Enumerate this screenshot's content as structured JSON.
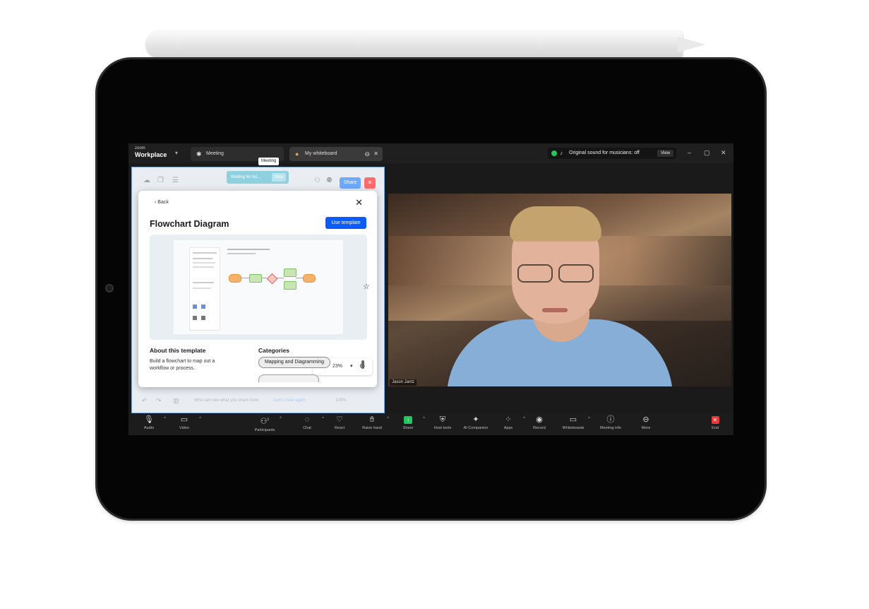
{
  "app": {
    "brand_top": "zoom",
    "brand_name": "Workplace"
  },
  "tabs": {
    "meeting_label": "Meeting",
    "meeting_tooltip": "Meeting",
    "whiteboard_label": "My whiteboard"
  },
  "status": {
    "original_sound": "Original sound for musicians: off",
    "view_label": "View"
  },
  "whiteboard": {
    "waiting_text": "Waiting for hd...",
    "stop_label": "Stop",
    "share_label": "Share",
    "bottom_hint": "Who can see what you share here",
    "bottom_link": "Don't show again",
    "zoom_footer": "100%"
  },
  "modal": {
    "back_label": "Back",
    "title": "Flowchart Diagram",
    "use_template_label": "Use template",
    "zoom_value": "23%",
    "about_heading": "About this template",
    "about_text": "Build a flowchart to map out a workflow or process.",
    "categories_heading": "Categories",
    "category_chip": "Mapping and Diagramming"
  },
  "video": {
    "participant_name": "Jason Jantz"
  },
  "toolbar": {
    "audio": "Audio",
    "video": "Video",
    "participants": "Participants",
    "participants_count": "1",
    "chat": "Chat",
    "react": "React",
    "raise_hand": "Raise hand",
    "share": "Share",
    "host_tools": "Host tools",
    "ai_companion": "AI Companion",
    "apps": "Apps",
    "record": "Record",
    "whiteboards": "Whiteboards",
    "meeting_info": "Meeting info",
    "more": "More",
    "end": "End"
  },
  "colors": {
    "accent_blue": "#0b5cff",
    "status_green": "#22c55e",
    "end_red": "#e53935"
  }
}
